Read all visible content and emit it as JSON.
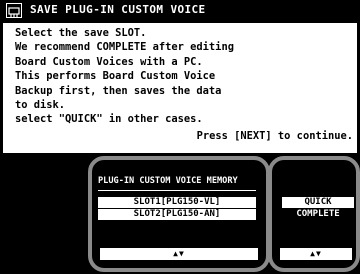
{
  "title": {
    "icon": "plugin-board-icon",
    "text": "SAVE PLUG-IN CUSTOM VOICE"
  },
  "message": {
    "lines": [
      "Select the save SLOT.",
      "We recommend COMPLETE after editing",
      "Board Custom Voices with a PC.",
      "This performs Board Custom Voice",
      "Backup first, then saves the data",
      "to disk.",
      "select \"QUICK\" in other cases."
    ],
    "continue": "Press [NEXT] to continue."
  },
  "memory": {
    "header": "PLUG-IN CUSTOM VOICE MEMORY",
    "slots": [
      "SLOT1[PLG150-VL]",
      "SLOT2[PLG150-AN]"
    ],
    "scroll_glyph": "▲▼"
  },
  "save_type": {
    "options": [
      "QUICK",
      "COMPLETE"
    ],
    "selected": "QUICK",
    "scroll_glyph": "▲▼"
  },
  "colors": {
    "background": "#000000",
    "panel": "#ffffff",
    "highlight_frame": "#8a8a8a"
  }
}
